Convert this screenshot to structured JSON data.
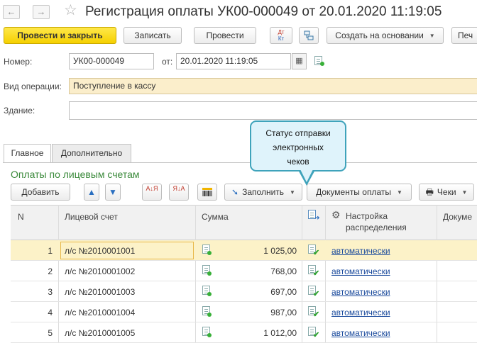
{
  "window": {
    "title": "Регистрация оплаты УК00-000049 от 20.01.2020 11:19:05"
  },
  "toolbar": {
    "post_close": "Провести и закрыть",
    "write": "Записать",
    "post": "Провести",
    "dt_kt_top": "Дт",
    "dt_kt_bottom": "Кт",
    "create_based": "Создать на основании",
    "print": "Печ"
  },
  "form": {
    "number_label": "Номер:",
    "number_value": "УК00-000049",
    "date_label": "от:",
    "date_value": "20.01.2020 11:19:05",
    "operation_label": "Вид операции:",
    "operation_value": "Поступление в кассу",
    "building_label": "Здание:",
    "building_value": ""
  },
  "tabs": [
    {
      "label": "Главное",
      "active": true
    },
    {
      "label": "Дополнительно",
      "active": false
    }
  ],
  "section": {
    "title": "Оплаты по лицевым счетам"
  },
  "table_toolbar": {
    "add": "Добавить",
    "fill": "Заполнить",
    "payment_docs": "Документы оплаты",
    "receipts": "Чеки",
    "sort_asc": "А↓Я",
    "sort_desc": "Я↓А"
  },
  "table": {
    "columns": {
      "n": "N",
      "account": "Лицевой счет",
      "amount": "Сумма",
      "settings_line1": "Настройка",
      "settings_line2": "распределения",
      "document": "Докуме"
    },
    "rows": [
      {
        "n": "1",
        "account": "л/с №2010001001",
        "amount": "1 025,00",
        "mode": "автоматически"
      },
      {
        "n": "2",
        "account": "л/с №2010001002",
        "amount": "768,00",
        "mode": "автоматически"
      },
      {
        "n": "3",
        "account": "л/с №2010001003",
        "amount": "697,00",
        "mode": "автоматически"
      },
      {
        "n": "4",
        "account": "л/с №2010001004",
        "amount": "987,00",
        "mode": "автоматически"
      },
      {
        "n": "5",
        "account": "л/с №2010001005",
        "amount": "1 012,00",
        "mode": "автоматически"
      }
    ]
  },
  "callout": {
    "line1": "Статус отправки",
    "line2": "электронных",
    "line3": "чеков"
  },
  "colors": {
    "primary_button": "#f5d000",
    "section_title": "#3b8a3b",
    "selected_row": "#fcf2c8",
    "callout_border": "#3fa3bb",
    "link": "#1a4a9c"
  }
}
